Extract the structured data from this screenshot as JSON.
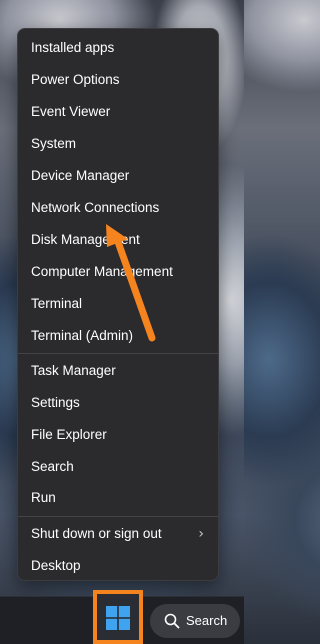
{
  "context_menu": {
    "group1": [
      "Installed apps",
      "Power Options",
      "Event Viewer",
      "System",
      "Device Manager",
      "Network Connections",
      "Disk Management",
      "Computer Management",
      "Terminal",
      "Terminal (Admin)"
    ],
    "group2": [
      "Task Manager",
      "Settings",
      "File Explorer",
      "Search",
      "Run"
    ],
    "group3": [
      "Shut down or sign out",
      "Desktop"
    ],
    "submenu_chevron": "›"
  },
  "taskbar": {
    "search_label": "Search",
    "start_icon": "windows-logo-icon",
    "search_icon": "search-icon"
  },
  "annotation": {
    "highlight_color": "#f5841f"
  },
  "colors": {
    "menu_background": "#2b2b2e",
    "menu_text": "#ffffff",
    "windows_blue": "#3fa3f0"
  }
}
